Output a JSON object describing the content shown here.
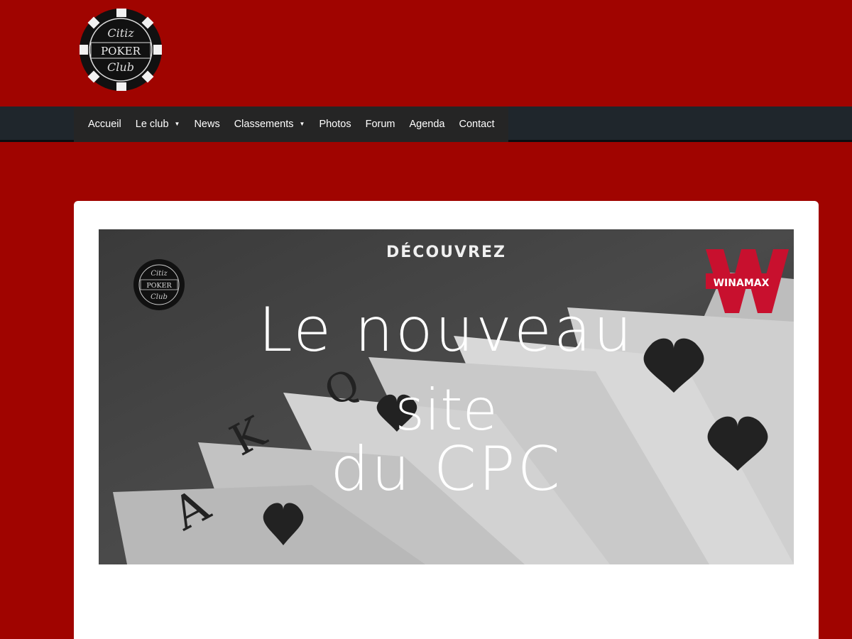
{
  "header": {
    "logo": {
      "alt": "Citiz Poker Club logo",
      "line1": "Citiz",
      "line2": "POKER",
      "line3": "Club"
    }
  },
  "nav": {
    "items": [
      {
        "label": "Accueil",
        "has_dropdown": false
      },
      {
        "label": "Le club",
        "has_dropdown": true
      },
      {
        "label": "News",
        "has_dropdown": false
      },
      {
        "label": "Classements",
        "has_dropdown": true
      },
      {
        "label": "Photos",
        "has_dropdown": false
      },
      {
        "label": "Forum",
        "has_dropdown": false
      },
      {
        "label": "Agenda",
        "has_dropdown": false
      },
      {
        "label": "Contact",
        "has_dropdown": false
      }
    ]
  },
  "banner": {
    "kicker": "DÉCOUVREZ",
    "line1": "Le nouveau",
    "line2": "site",
    "line3": "du CPC",
    "sponsor": "WINAMAX",
    "sponsor_mark": "W",
    "club_logo": {
      "line1": "Citiz",
      "line2": "POKER",
      "line3": "Club"
    }
  },
  "colors": {
    "background": "#a00400",
    "navbar": "#1f262c",
    "card": "#ffffff",
    "winamax_red": "#c8102e"
  }
}
